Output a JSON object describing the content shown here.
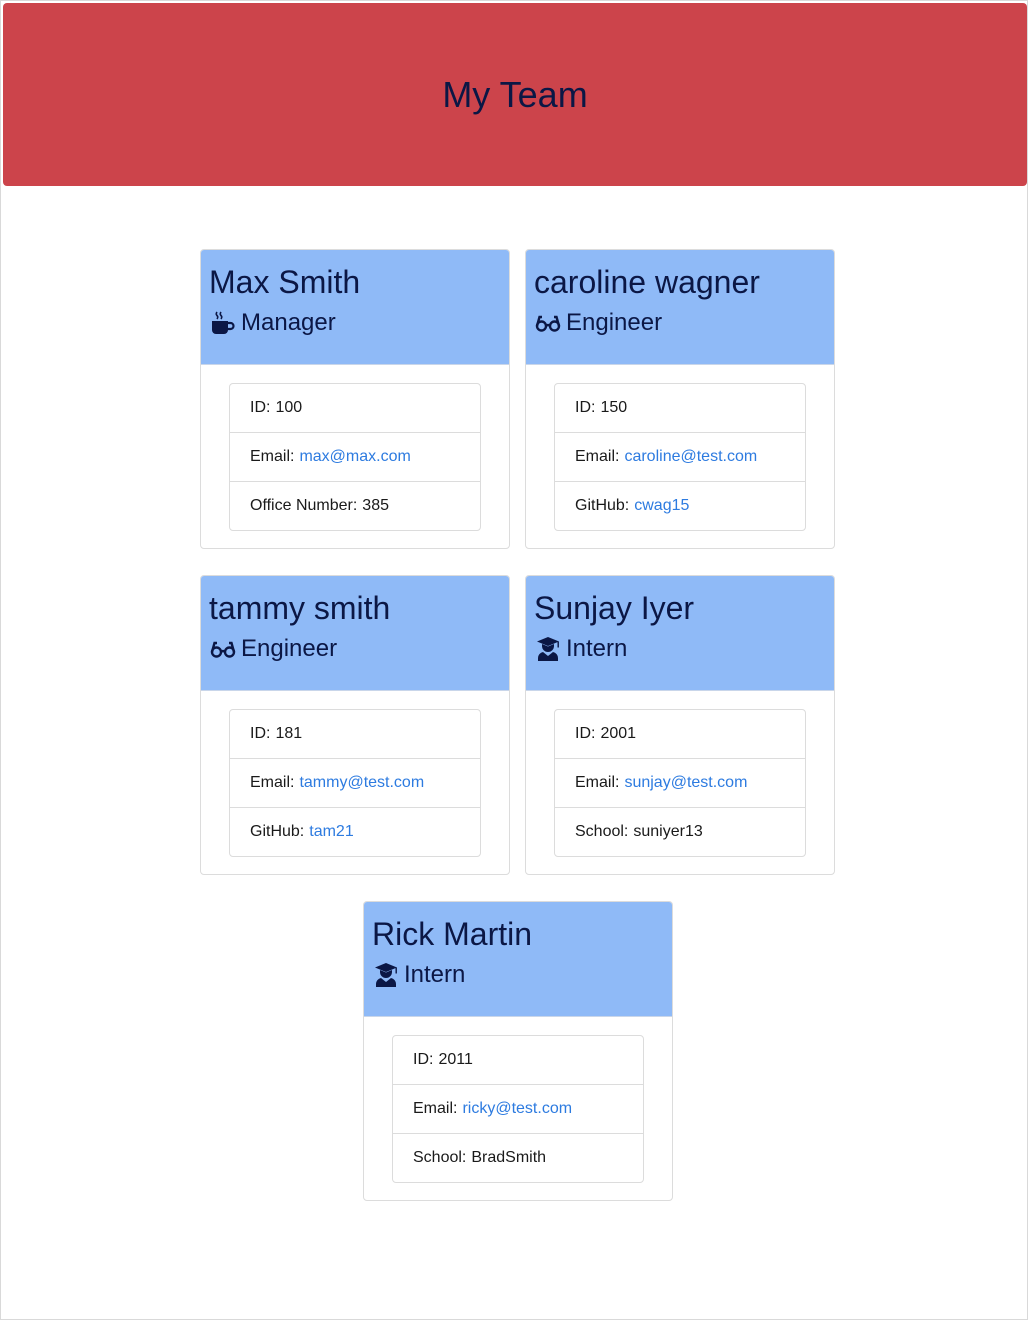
{
  "header": {
    "title": "My Team"
  },
  "cards": [
    {
      "name": "Max Smith",
      "role": "Manager",
      "role_icon": "coffee-mug-icon",
      "id_label": "ID:",
      "id": "100",
      "email_label": "Email:",
      "email": "max@max.com",
      "extra_label": "Office Number:",
      "extra": "385"
    },
    {
      "name": "caroline wagner",
      "role": "Engineer",
      "role_icon": "glasses-icon",
      "id_label": "ID:",
      "id": "150",
      "email_label": "Email:",
      "email": "caroline@test.com",
      "extra_label": "GitHub:",
      "extra": "cwag15"
    },
    {
      "name": "tammy smith",
      "role": "Engineer",
      "role_icon": "glasses-icon",
      "id_label": "ID:",
      "id": "181",
      "email_label": "Email:",
      "email": "tammy@test.com",
      "extra_label": "GitHub:",
      "extra": "tam21"
    },
    {
      "name": "Sunjay Iyer",
      "role": "Intern",
      "role_icon": "graduate-icon",
      "id_label": "ID:",
      "id": "2001",
      "email_label": "Email:",
      "email": "sunjay@test.com",
      "extra_label": "School:",
      "extra": "suniyer13"
    },
    {
      "name": "Rick Martin",
      "role": "Intern",
      "role_icon": "graduate-icon",
      "id_label": "ID:",
      "id": "2011",
      "email_label": "Email:",
      "email": "ricky@test.com",
      "extra_label": "School:",
      "extra": "BradSmith"
    }
  ],
  "colors": {
    "header_bg": "#cc444b",
    "card_header_bg": "#8fbaf7",
    "title_text": "#0b1745",
    "link": "#2d7be0"
  }
}
